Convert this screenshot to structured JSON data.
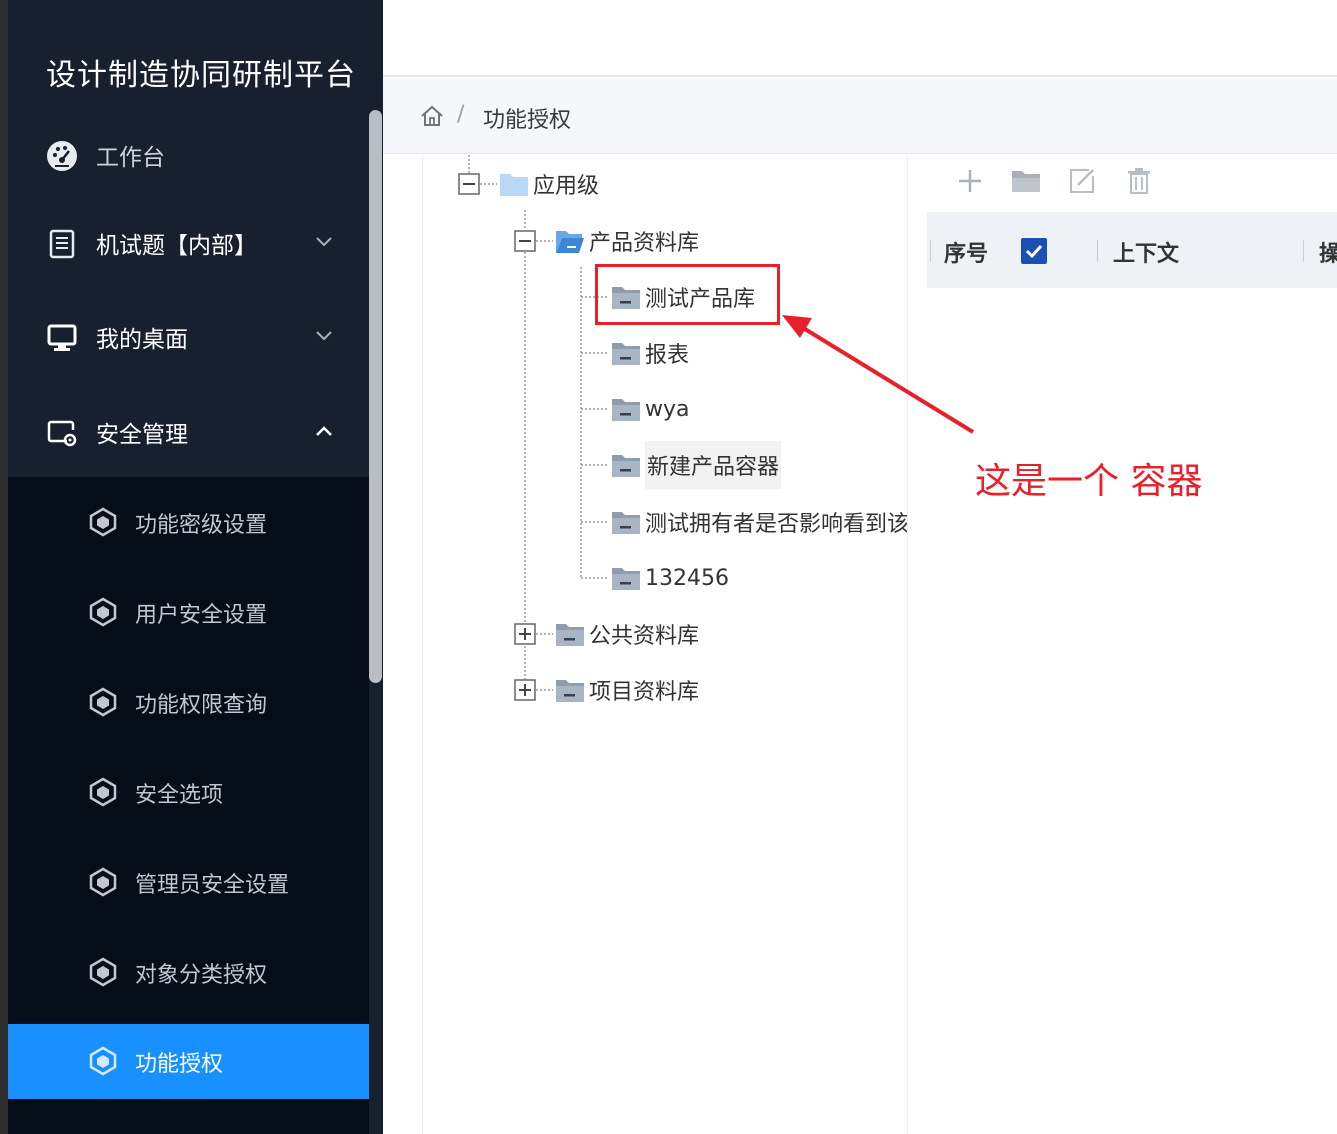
{
  "brand": "设计制造协同研制平台",
  "menu": [
    {
      "label": "工作台",
      "icon": "dashboard-icon"
    },
    {
      "label": "机试题【内部】",
      "icon": "document-icon",
      "arrow": "chevron-down-icon"
    },
    {
      "label": "我的桌面",
      "icon": "monitor-icon",
      "arrow": "chevron-down-icon"
    },
    {
      "label": "安全管理",
      "icon": "security-settings-icon",
      "arrow": "chevron-up-icon"
    }
  ],
  "submenu": [
    {
      "label": "功能密级设置"
    },
    {
      "label": "用户安全设置"
    },
    {
      "label": "功能权限查询"
    },
    {
      "label": "安全选项"
    },
    {
      "label": "管理员安全设置"
    },
    {
      "label": "对象分类授权"
    },
    {
      "label": "功能授权",
      "active": true
    }
  ],
  "breadcrumb": {
    "separator": "/",
    "current": "功能授权"
  },
  "tree": {
    "root": "应用级",
    "product_lib": "产品资料库",
    "children": [
      "测试产品库",
      "报表",
      "wya",
      "新建产品容器",
      "测试拥有者是否影响看到该",
      "132456"
    ],
    "public_lib": "公共资料库",
    "project_lib": "项目资料库"
  },
  "toolbar": {
    "add": "plus-icon",
    "folder": "folder-icon",
    "edit": "edit-icon",
    "delete": "trash-icon"
  },
  "grid": {
    "columns": [
      "序号",
      "上下文",
      "操"
    ]
  },
  "annotation": {
    "text": "这是一个 容器",
    "color": "#e8202a"
  },
  "colors": {
    "sidebar_bg": "#16202f",
    "submenu_bg": "#040d18",
    "active": "#1890ff"
  }
}
